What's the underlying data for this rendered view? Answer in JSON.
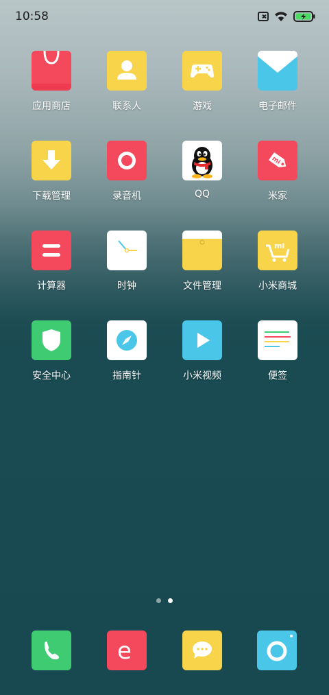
{
  "status_bar": {
    "time": "10:58"
  },
  "apps": [
    {
      "name": "应用商店",
      "icon": "app-store-icon"
    },
    {
      "name": "联系人",
      "icon": "contacts-icon"
    },
    {
      "name": "游戏",
      "icon": "game-icon"
    },
    {
      "name": "电子邮件",
      "icon": "email-icon"
    },
    {
      "name": "下载管理",
      "icon": "download-icon"
    },
    {
      "name": "录音机",
      "icon": "recorder-icon"
    },
    {
      "name": "QQ",
      "icon": "qq-icon"
    },
    {
      "name": "米家",
      "icon": "mijia-icon"
    },
    {
      "name": "计算器",
      "icon": "calculator-icon"
    },
    {
      "name": "时钟",
      "icon": "clock-icon"
    },
    {
      "name": "文件管理",
      "icon": "file-manager-icon"
    },
    {
      "name": "小米商城",
      "icon": "mi-store-icon"
    },
    {
      "name": "安全中心",
      "icon": "security-icon"
    },
    {
      "name": "指南针",
      "icon": "compass-icon"
    },
    {
      "name": "小米视频",
      "icon": "video-icon"
    },
    {
      "name": "便签",
      "icon": "notes-icon"
    }
  ],
  "dock": [
    {
      "icon": "phone-icon"
    },
    {
      "icon": "browser-icon"
    },
    {
      "icon": "messages-icon"
    },
    {
      "icon": "camera-icon"
    }
  ],
  "pages": {
    "count": 2,
    "active": 2
  },
  "colors": {
    "red": "#f4485c",
    "yellow": "#f7d44a",
    "blue": "#4ac6e8",
    "green": "#3ecb72",
    "white": "#ffffff"
  }
}
